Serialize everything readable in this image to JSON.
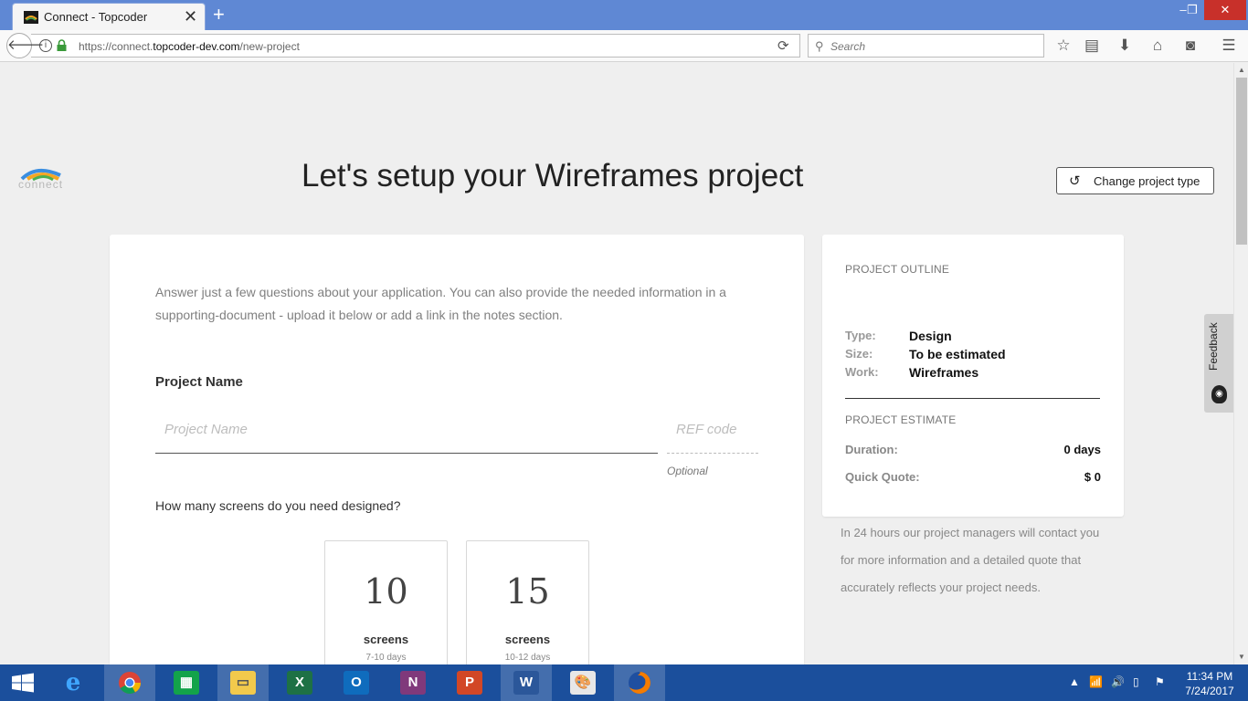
{
  "browser": {
    "tab_title": "Connect - Topcoder",
    "tab_close": "✕",
    "new_tab": "+",
    "url_prefix": "https://connect.",
    "url_domain": "topcoder-dev.com",
    "url_path": "/new-project",
    "search_placeholder": "Search",
    "window_controls": {
      "minimize": "‒",
      "maximize": "❐",
      "close": "✕"
    }
  },
  "header": {
    "logo_text": "connect",
    "title": "Let's setup your Wireframes project",
    "change_button": "Change project type"
  },
  "form": {
    "intro": "Answer just a few questions about your application. You can also provide the needed information in a supporting-document - upload it below or add a link in the notes section.",
    "project_name_label": "Project Name",
    "project_name_placeholder": "Project Name",
    "ref_placeholder": "REF code",
    "ref_hint": "Optional",
    "screens_question": "How many screens do you need designed?",
    "options": [
      {
        "number": "10",
        "unit": "screens",
        "days": "7-10 days"
      },
      {
        "number": "15",
        "unit": "screens",
        "days": "10-12 days"
      }
    ]
  },
  "outline": {
    "heading": "PROJECT OUTLINE",
    "rows": [
      {
        "key": "Type:",
        "value": "Design"
      },
      {
        "key": "Size:",
        "value": "To be estimated"
      },
      {
        "key": "Work:",
        "value": "Wireframes"
      }
    ],
    "estimate_heading": "PROJECT ESTIMATE",
    "duration_label": "Duration:",
    "duration_value": "0 days",
    "quote_label": "Quick Quote:",
    "quote_value": "$ 0",
    "note": "In 24 hours our project managers will contact you for more information and a detailed quote that accurately reflects your project needs."
  },
  "feedback": {
    "label": "Feedback"
  },
  "taskbar": {
    "apps": [
      "internet-explorer",
      "chrome",
      "store",
      "file-explorer",
      "excel",
      "outlook",
      "onenote",
      "powerpoint",
      "word",
      "paint",
      "firefox"
    ],
    "time": "11:34 PM",
    "date": "7/24/2017"
  },
  "colors": {
    "titlebar": "#5f88d4",
    "taskbar": "#1b4f9c",
    "page_bg": "#efefef",
    "close": "#c8302a"
  }
}
